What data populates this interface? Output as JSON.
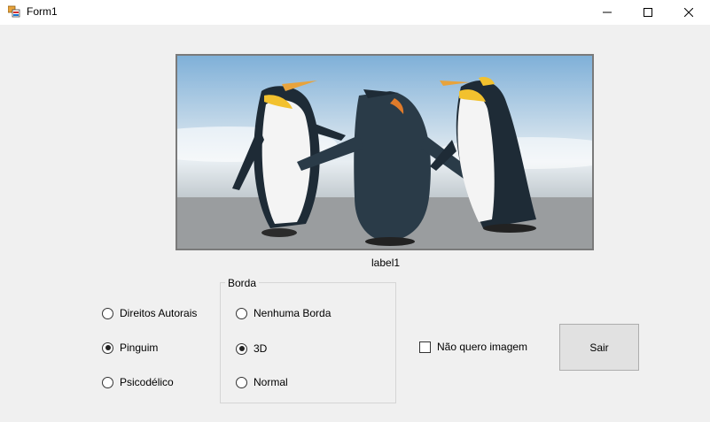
{
  "window": {
    "title": "Form1",
    "icon": "winforms-app-icon",
    "controls": [
      "minimize-icon",
      "maximize-icon",
      "close-icon"
    ]
  },
  "picture": {
    "description_icon": "image-penguins"
  },
  "label1": {
    "text": "label1"
  },
  "image_options": [
    {
      "label": "Direitos Autorais",
      "checked": false
    },
    {
      "label": "Pinguim",
      "checked": true
    },
    {
      "label": "Psicodélico",
      "checked": false
    }
  ],
  "border_group": {
    "title": "Borda",
    "options": [
      {
        "label": "Nenhuma Borda",
        "checked": false
      },
      {
        "label": "3D",
        "checked": true
      },
      {
        "label": "Normal",
        "checked": false
      }
    ]
  },
  "no_image_checkbox": {
    "label": "Não quero imagem",
    "checked": false
  },
  "exit_button": {
    "label": "Sair"
  }
}
